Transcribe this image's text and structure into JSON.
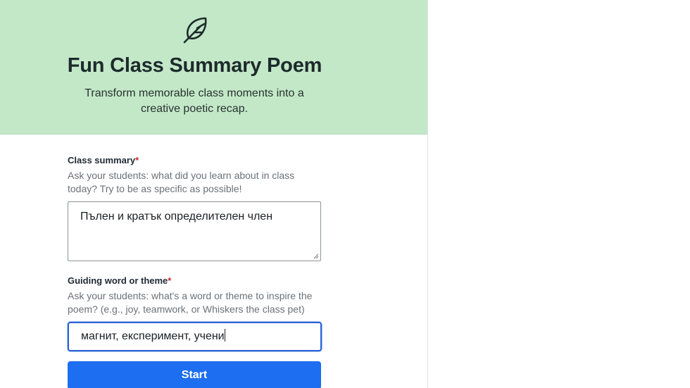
{
  "header": {
    "icon": "feather-icon",
    "title": "Fun Class Summary Poem",
    "subtitle": "Transform memorable class moments into a creative poetic recap.",
    "background_color": "#c3e8c8"
  },
  "form": {
    "summary": {
      "label": "Class summary",
      "required_mark": "*",
      "help": "Ask your students: what did you learn about in class today? Try to be as specific as possible!",
      "value": "Пълен и кратък определителен член"
    },
    "theme": {
      "label": "Guiding word or theme",
      "required_mark": "*",
      "help": "Ask your students: what's a word or theme to inspire the poem? (e.g., joy, teamwork, or Whiskers the class pet)",
      "value": "магнит, експеримент, учени"
    },
    "submit_label": "Start",
    "accent_color": "#1d6ef0"
  }
}
